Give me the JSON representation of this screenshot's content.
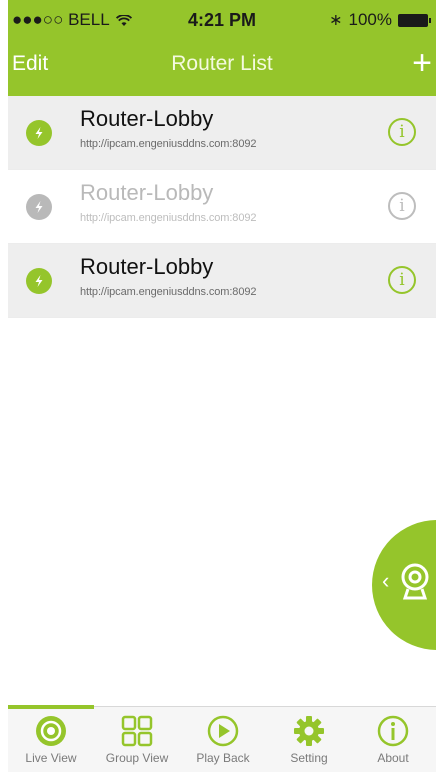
{
  "status_bar": {
    "carrier": "●●●○○ BELL",
    "time": "4:21 PM",
    "battery": "100%"
  },
  "nav": {
    "edit_label": "Edit",
    "title": "Router List",
    "add_label": "+"
  },
  "routers": [
    {
      "name": "Router-Lobby",
      "url": "http://ipcam.engeniusddns.com:8092",
      "info": "i",
      "state": "online"
    },
    {
      "name": "Router-Lobby",
      "url": "http://ipcam.engeniusddns.com:8092",
      "info": "i",
      "state": "offline"
    },
    {
      "name": "Router-Lobby",
      "url": "http://ipcam.engeniusddns.com:8092",
      "info": "i",
      "state": "online"
    }
  ],
  "tabs": [
    {
      "label": "Live View",
      "icon": "live-view-icon",
      "active": true
    },
    {
      "label": "Group View",
      "icon": "grid-icon",
      "active": false
    },
    {
      "label": "Play Back",
      "icon": "play-icon",
      "active": false
    },
    {
      "label": "Setting",
      "icon": "gear-icon",
      "active": false
    },
    {
      "label": "About",
      "icon": "info-icon",
      "active": false
    }
  ],
  "colors": {
    "accent": "#95c52b",
    "disabled": "#b9b9b9"
  }
}
